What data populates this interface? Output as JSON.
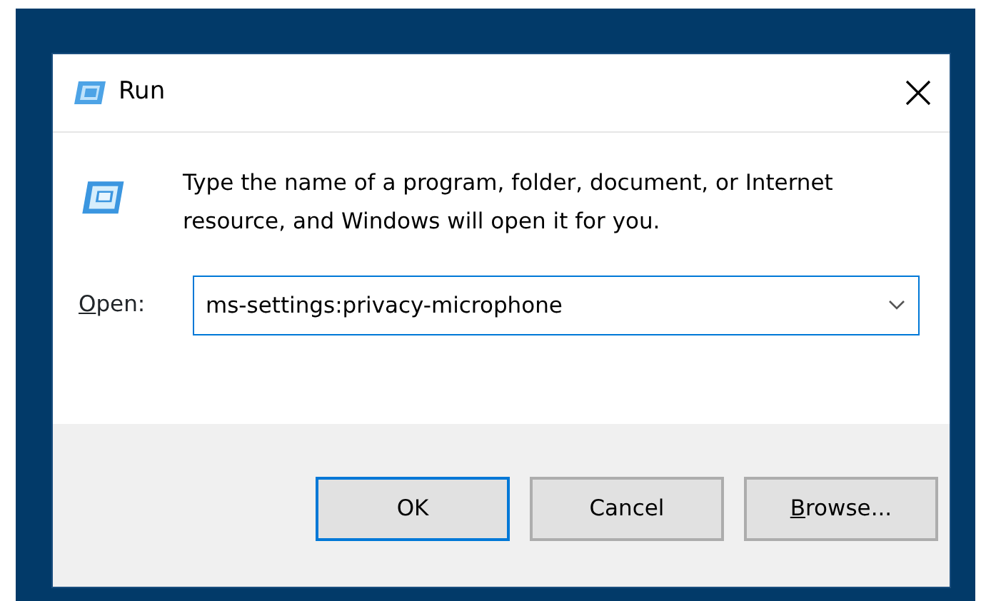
{
  "window": {
    "title": "Run"
  },
  "message": "Type the name of a program, folder, document, or Internet resource, and Windows will open it for you.",
  "open_field": {
    "label": "Open:",
    "mnemonic": true,
    "value": "ms-settings:privacy-microphone"
  },
  "buttons": [
    {
      "label": "OK",
      "default": true,
      "mnemonic": false
    },
    {
      "label": "Cancel",
      "default": false,
      "mnemonic": false
    },
    {
      "label": "Browse...",
      "default": false,
      "mnemonic": true
    }
  ]
}
